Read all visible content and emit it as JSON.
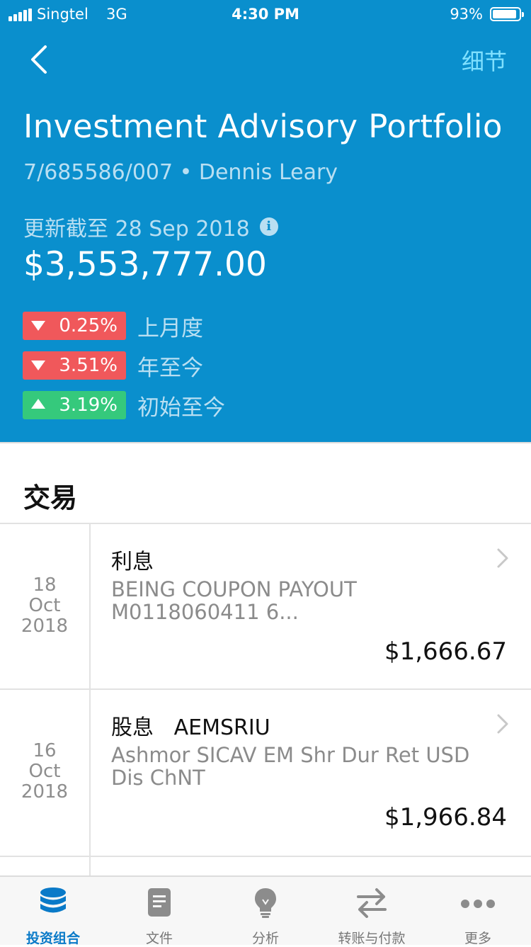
{
  "status_bar": {
    "carrier": "Singtel",
    "network": "3G",
    "time": "4:30 PM",
    "battery_percent": "93%",
    "battery_level": 0.93
  },
  "nav": {
    "back_icon": "chevron-left-icon",
    "detail_label": "细节"
  },
  "portfolio": {
    "title": "Investment Advisory Portfolio",
    "subtitle": "7/685586/007 • Dennis Leary",
    "updated": "更新截至 28 Sep 2018",
    "info_icon": "i",
    "balance": "$3,553,777.00",
    "performance": [
      {
        "direction": "down",
        "value": "0.25%",
        "label": "上月度"
      },
      {
        "direction": "down",
        "value": "3.51%",
        "label": "年至今"
      },
      {
        "direction": "up",
        "value": "3.19%",
        "label": "初始至今"
      }
    ]
  },
  "transactions": {
    "title": "交易",
    "items": [
      {
        "day": "18",
        "month": "Oct",
        "year": "2018",
        "type": "利息",
        "desc": "BEING COUPON PAYOUT M0118060411  6...",
        "amount": "$1,666.67"
      },
      {
        "day": "16",
        "month": "Oct",
        "year": "2018",
        "type": "股息   AEMSRIU",
        "desc": "Ashmor SICAV EM Shr Dur Ret USD Dis ChNT",
        "amount": "$1,966.84"
      }
    ]
  },
  "tabbar": {
    "tabs": [
      {
        "label": "投资组合",
        "icon": "database-icon",
        "active": true
      },
      {
        "label": "文件",
        "icon": "document-icon",
        "active": false
      },
      {
        "label": "分析",
        "icon": "lightbulb-icon",
        "active": false
      },
      {
        "label": "转账与付款",
        "icon": "transfer-arrows-icon",
        "active": false
      },
      {
        "label": "更多",
        "icon": "more-dots-icon",
        "active": false
      }
    ]
  },
  "colors": {
    "header_bg": "#0a8fcd",
    "negative": "#f0585b",
    "positive": "#35c97c",
    "active_tab": "#0a7ac8",
    "detail_link": "#7fe0ff"
  }
}
